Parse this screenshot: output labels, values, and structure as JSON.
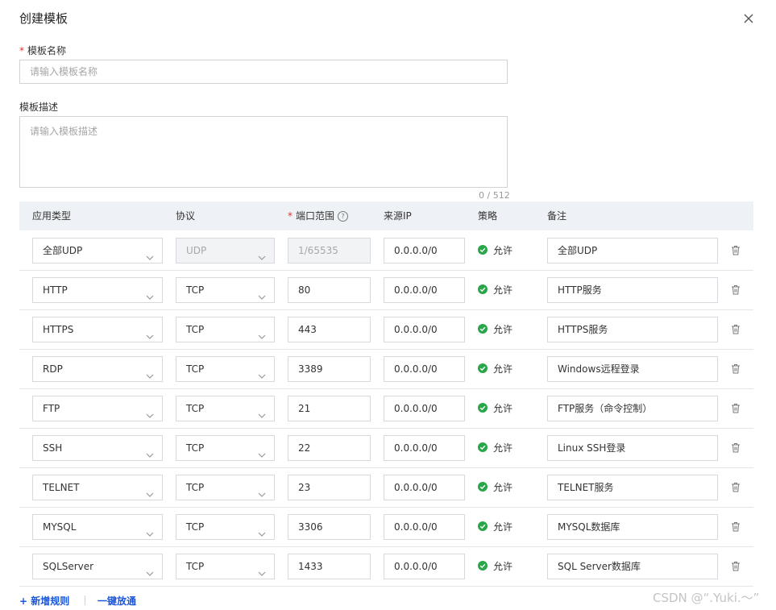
{
  "dialog": {
    "title": "创建模板",
    "close_icon": "close-icon"
  },
  "form": {
    "name_required_mark": "*",
    "name_label": "模板名称",
    "name_placeholder": "请输入模板名称",
    "desc_label": "模板描述",
    "desc_placeholder": "请输入模板描述",
    "desc_counter": "0 / 512"
  },
  "table": {
    "headers": {
      "type": "应用类型",
      "protocol": "协议",
      "port_required_mark": "*",
      "port": "端口范围",
      "help": "?",
      "source_ip": "来源IP",
      "policy": "策略",
      "note": "备注"
    },
    "rows": [
      {
        "type": "全部UDP",
        "protocol": "UDP",
        "port": "1/65535",
        "source_ip": "0.0.0.0/0",
        "policy": "允许",
        "note": "全部UDP",
        "locked": true
      },
      {
        "type": "HTTP",
        "protocol": "TCP",
        "port": "80",
        "source_ip": "0.0.0.0/0",
        "policy": "允许",
        "note": "HTTP服务",
        "locked": false
      },
      {
        "type": "HTTPS",
        "protocol": "TCP",
        "port": "443",
        "source_ip": "0.0.0.0/0",
        "policy": "允许",
        "note": "HTTPS服务",
        "locked": false
      },
      {
        "type": "RDP",
        "protocol": "TCP",
        "port": "3389",
        "source_ip": "0.0.0.0/0",
        "policy": "允许",
        "note": "Windows远程登录",
        "locked": false
      },
      {
        "type": "FTP",
        "protocol": "TCP",
        "port": "21",
        "source_ip": "0.0.0.0/0",
        "policy": "允许",
        "note": "FTP服务（命令控制）",
        "locked": false
      },
      {
        "type": "SSH",
        "protocol": "TCP",
        "port": "22",
        "source_ip": "0.0.0.0/0",
        "policy": "允许",
        "note": "Linux SSH登录",
        "locked": false
      },
      {
        "type": "TELNET",
        "protocol": "TCP",
        "port": "23",
        "source_ip": "0.0.0.0/0",
        "policy": "允许",
        "note": "TELNET服务",
        "locked": false
      },
      {
        "type": "MYSQL",
        "protocol": "TCP",
        "port": "3306",
        "source_ip": "0.0.0.0/0",
        "policy": "允许",
        "note": "MYSQL数据库",
        "locked": false
      },
      {
        "type": "SQLServer",
        "protocol": "TCP",
        "port": "1433",
        "source_ip": "0.0.0.0/0",
        "policy": "允许",
        "note": "SQL Server数据库",
        "locked": false
      }
    ]
  },
  "footer": {
    "add_rule_label": "+ 新增规则",
    "allow_all_label": "一键放通"
  },
  "watermark": "CSDN @“.Yuki.～”",
  "colors": {
    "accent": "#1a56db",
    "success": "#2aa64a",
    "required": "#e0342a",
    "header_bg": "#eef1f5"
  }
}
